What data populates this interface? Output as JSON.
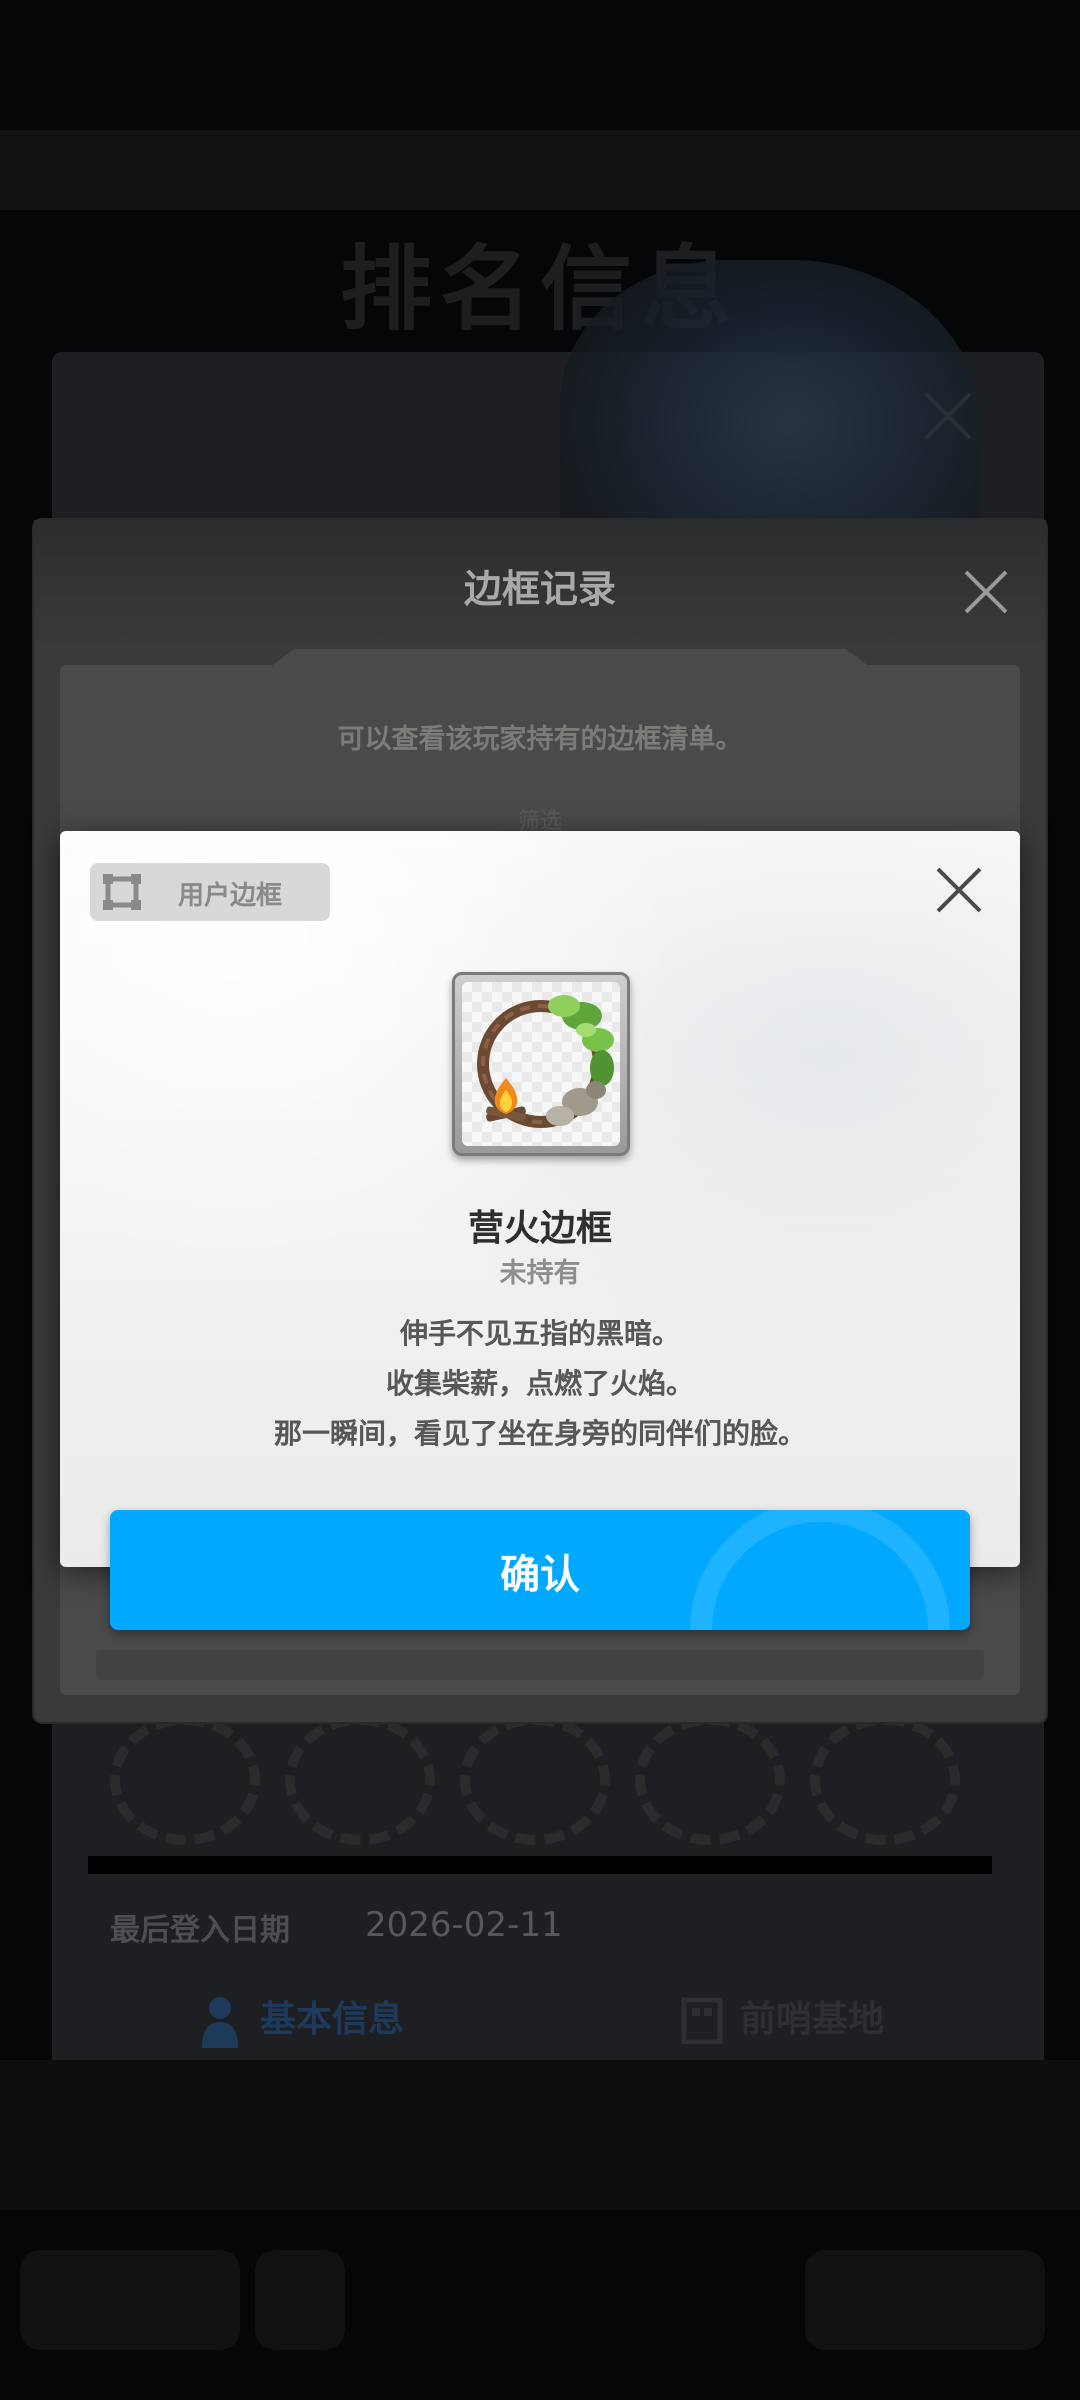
{
  "background": {
    "page_title": "排名信息",
    "close_icon": "close-icon",
    "last_login": {
      "label": "最后登入日期",
      "value": "2026-02-11"
    },
    "tabs": [
      {
        "label": "基本信息",
        "icon": "person-icon"
      },
      {
        "label": "前哨基地",
        "icon": "building-icon"
      }
    ]
  },
  "frame_record": {
    "title": "边框记录",
    "description": "可以查看该玩家持有的边框清单。",
    "filter_label": "筛选",
    "close_icon": "close-icon"
  },
  "frame_detail": {
    "type_badge": {
      "icon": "frame-icon",
      "label": "用户边框"
    },
    "close_icon": "close-icon",
    "item": {
      "icon": "campfire-frame-icon",
      "name": "营火边框",
      "status": "未持有",
      "description_lines": [
        "伸手不见五指的黑暗。",
        "收集柴薪，点燃了火焰。",
        "那一瞬间，看见了坐在身旁的同伴们的脸。"
      ]
    },
    "confirm_label": "确认"
  },
  "colors": {
    "accent": "#00a8ff",
    "dialog_bg": "#f2f2f2",
    "overlay": "#050607"
  }
}
